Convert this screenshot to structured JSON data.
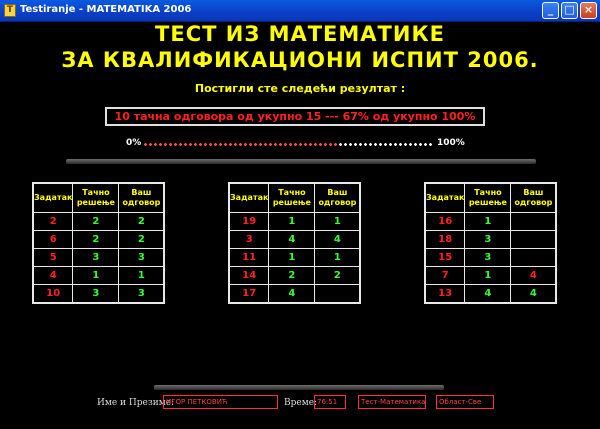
{
  "window": {
    "title": "Testiranje - MATEMATIKA 2006",
    "icon": "T",
    "buttons": {
      "minimize": "_",
      "maximize": "□",
      "close": "×"
    }
  },
  "heading": {
    "line1": "ТЕСТ ИЗ МАТЕМАТИКЕ",
    "line2": "ЗА КВАЛИФИКАЦИОНИ ИСПИТ 2006."
  },
  "subheading": "Постигли сте следећи резултат :",
  "result": {
    "text": "10 тачна одговора од укупно 15   ---   67% од укупно 100%",
    "correct": 10,
    "total": 15,
    "percent": 67
  },
  "progress": {
    "min_label": "0%",
    "max_label": "100%",
    "fraction": 0.67
  },
  "table_headers": {
    "task": "Задатак",
    "correct": "Тачно решење",
    "yours": "Ваш одговор"
  },
  "tables": [
    {
      "rows": [
        {
          "task": "2",
          "correct": "2",
          "answer": "2",
          "status": "ok"
        },
        {
          "task": "6",
          "correct": "2",
          "answer": "2",
          "status": "ok"
        },
        {
          "task": "5",
          "correct": "3",
          "answer": "3",
          "status": "ok"
        },
        {
          "task": "4",
          "correct": "1",
          "answer": "1",
          "status": "ok"
        },
        {
          "task": "10",
          "correct": "3",
          "answer": "3",
          "status": "ok"
        }
      ]
    },
    {
      "rows": [
        {
          "task": "19",
          "correct": "1",
          "answer": "1",
          "status": "ok"
        },
        {
          "task": "3",
          "correct": "4",
          "answer": "4",
          "status": "ok"
        },
        {
          "task": "11",
          "correct": "1",
          "answer": "1",
          "status": "ok"
        },
        {
          "task": "14",
          "correct": "2",
          "answer": "2",
          "status": "ok"
        },
        {
          "task": "17",
          "correct": "4",
          "answer": "",
          "status": "empty"
        }
      ]
    },
    {
      "rows": [
        {
          "task": "16",
          "correct": "1",
          "answer": "",
          "status": "empty"
        },
        {
          "task": "18",
          "correct": "3",
          "answer": "",
          "status": "empty"
        },
        {
          "task": "15",
          "correct": "3",
          "answer": "",
          "status": "empty"
        },
        {
          "task": "7",
          "correct": "1",
          "answer": "4",
          "status": "bad"
        },
        {
          "task": "13",
          "correct": "4",
          "answer": "4",
          "status": "ok"
        }
      ]
    }
  ],
  "footer": {
    "name_label": "Име и Презиме:",
    "name_value": "ИГОР ПЕТКОВИЋ",
    "time_label": "Време:",
    "time_value": "76:51",
    "test_value": "Тест-Математика",
    "area_value": "Област-Све"
  },
  "colors": {
    "background": "#000000",
    "heading": "#ffff00",
    "correct": "#33ff33",
    "wrong": "#ff2020",
    "titlebar": "#0b3fc8"
  }
}
